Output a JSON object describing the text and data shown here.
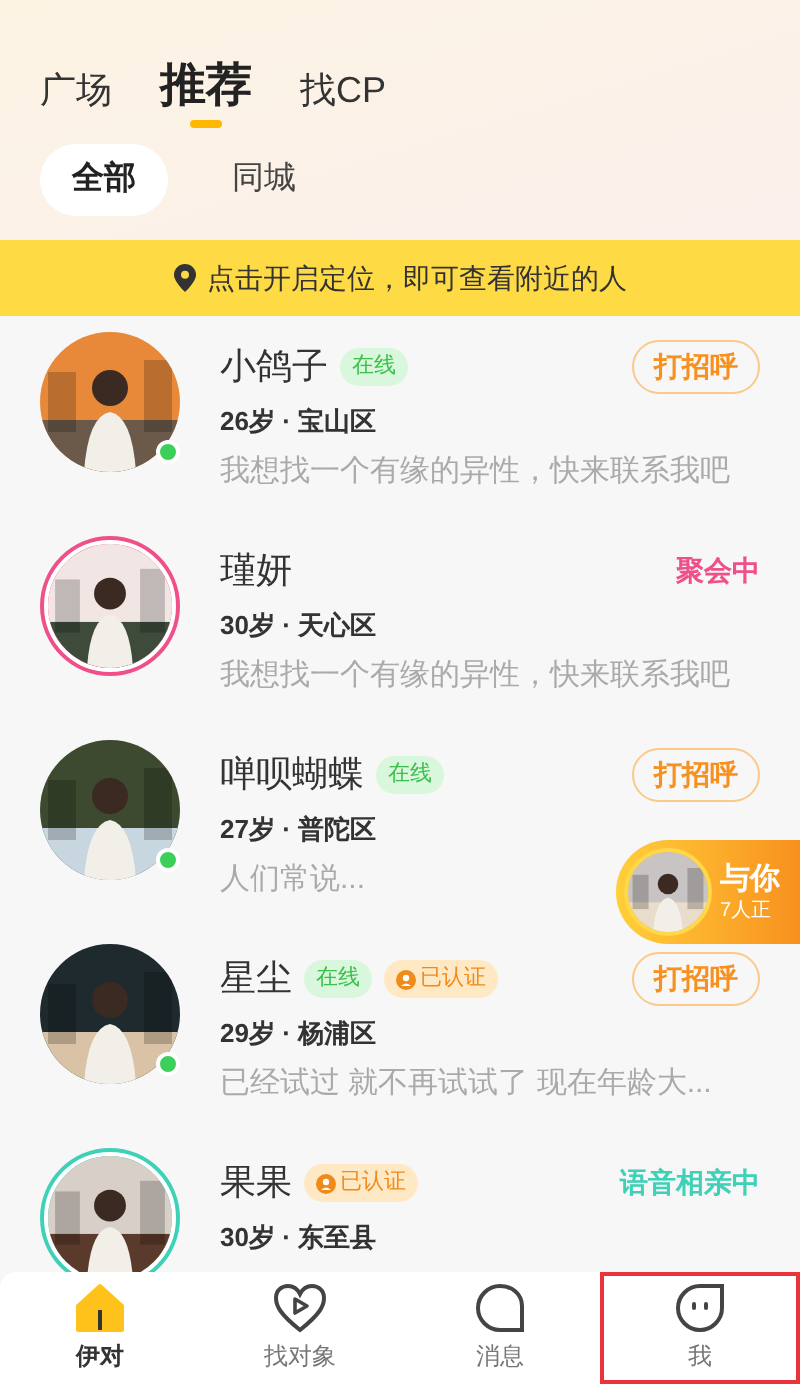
{
  "top_tabs": [
    {
      "label": "广场",
      "selected": false
    },
    {
      "label": "推荐",
      "selected": true
    },
    {
      "label": "找CP",
      "selected": false
    }
  ],
  "filters": [
    {
      "label": "全部",
      "selected": true
    },
    {
      "label": "同城",
      "selected": false
    }
  ],
  "location_banner": "点击开启定位，即可查看附近的人",
  "users": [
    {
      "name": "小鸽子",
      "tags": [
        {
          "kind": "online",
          "label": "在线"
        }
      ],
      "info": "26岁 · 宝山区",
      "bio": "我想找一个有缘的异性，快来联系我吧",
      "online": true,
      "action": {
        "kind": "button",
        "label": "打招呼"
      }
    },
    {
      "name": "瑾妍",
      "info": "30岁 · 天心区",
      "bio": "我想找一个有缘的异性，快来联系我吧",
      "online": false,
      "action": {
        "kind": "status",
        "label": "聚会中",
        "color": "#f0508a"
      }
    },
    {
      "name": "啴呗蝴蝶",
      "tags": [
        {
          "kind": "online",
          "label": "在线"
        }
      ],
      "info": "27岁 · 普陀区",
      "bio": "人们常说...",
      "online": true,
      "action": {
        "kind": "button",
        "label": "打招呼"
      }
    },
    {
      "name": "星尘",
      "tags": [
        {
          "kind": "online",
          "label": "在线"
        },
        {
          "kind": "verified",
          "label": "已认证"
        }
      ],
      "info": "29岁 · 杨浦区",
      "bio": "已经试过  就不再试试了 现在年龄大...",
      "online": true,
      "action": {
        "kind": "button",
        "label": "打招呼"
      }
    },
    {
      "name": "果果",
      "tags": [
        {
          "kind": "verified",
          "label": "已认证"
        }
      ],
      "info": "30岁 · 东至县",
      "online": false,
      "action": {
        "kind": "status",
        "label": "语音相亲中",
        "color": "#3fd0b8"
      }
    }
  ],
  "live_bubble": {
    "title": "与你",
    "subtitle": "7人正"
  },
  "nav": [
    {
      "label": "伊对",
      "selected": true,
      "highlighted": false
    },
    {
      "label": "找对象",
      "selected": false,
      "highlighted": false
    },
    {
      "label": "消息",
      "selected": false,
      "highlighted": false
    },
    {
      "label": "我",
      "selected": false,
      "highlighted": true
    }
  ]
}
